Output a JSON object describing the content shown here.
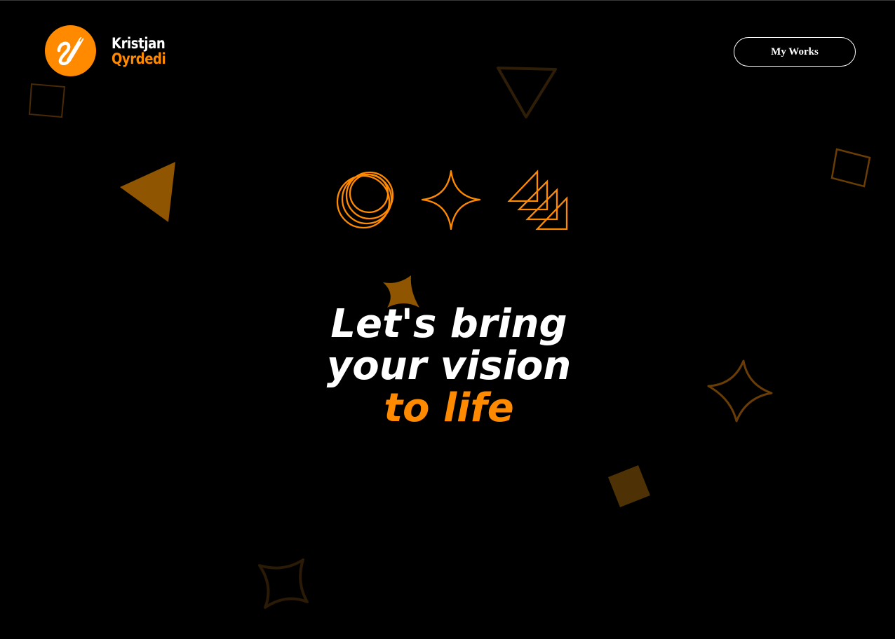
{
  "brand": {
    "first_name": "Kristjan",
    "last_name": "Qyrdedi",
    "logo_icon": "paintbrush-icon",
    "accent_color": "#ff8a00"
  },
  "nav": {
    "works_label": "My Works"
  },
  "hero": {
    "line1": "Let's bring",
    "line2": "your vision",
    "line3": "to life",
    "feature_icons": [
      "rings-icon",
      "sparkle-icon",
      "stacked-triangles-icon"
    ]
  },
  "decorations": [
    "outline-square-icon",
    "outline-triangle-icon",
    "filled-triangle-icon",
    "outline-square-icon",
    "filled-star-icon",
    "outline-star-icon",
    "filled-diamond-icon",
    "outline-star-icon"
  ],
  "colors": {
    "background": "#000000",
    "accent": "#ff8a00",
    "text": "#ffffff"
  }
}
